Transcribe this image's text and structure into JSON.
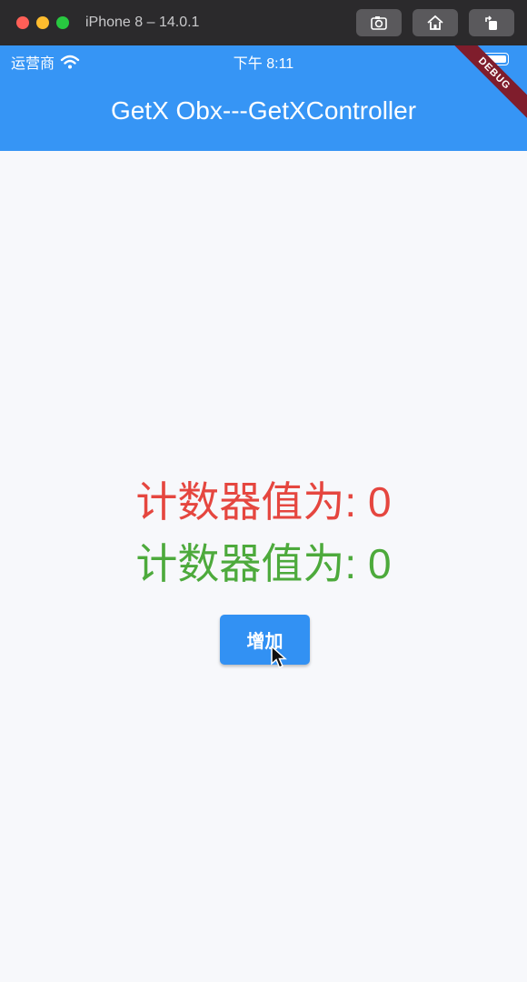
{
  "window": {
    "title": "iPhone 8 – 14.0.1",
    "buttons": [
      {
        "name": "screenshot-button",
        "icon": "camera-icon"
      },
      {
        "name": "home-button",
        "icon": "home-icon"
      },
      {
        "name": "rotate-button",
        "icon": "rotate-icon"
      }
    ]
  },
  "status_bar": {
    "carrier": "运营商",
    "time": "下午 8:11"
  },
  "app_bar": {
    "title": "GetX Obx---GetXController",
    "ribbon": "DEBUG",
    "color": "#3695f5"
  },
  "main": {
    "counter_red": "计数器值为: 0",
    "counter_green": "计数器值为: 0",
    "increment_label": "增加"
  },
  "colors": {
    "red_text": "#e5463f",
    "green_text": "#4daa3c",
    "button": "#3291f3"
  }
}
